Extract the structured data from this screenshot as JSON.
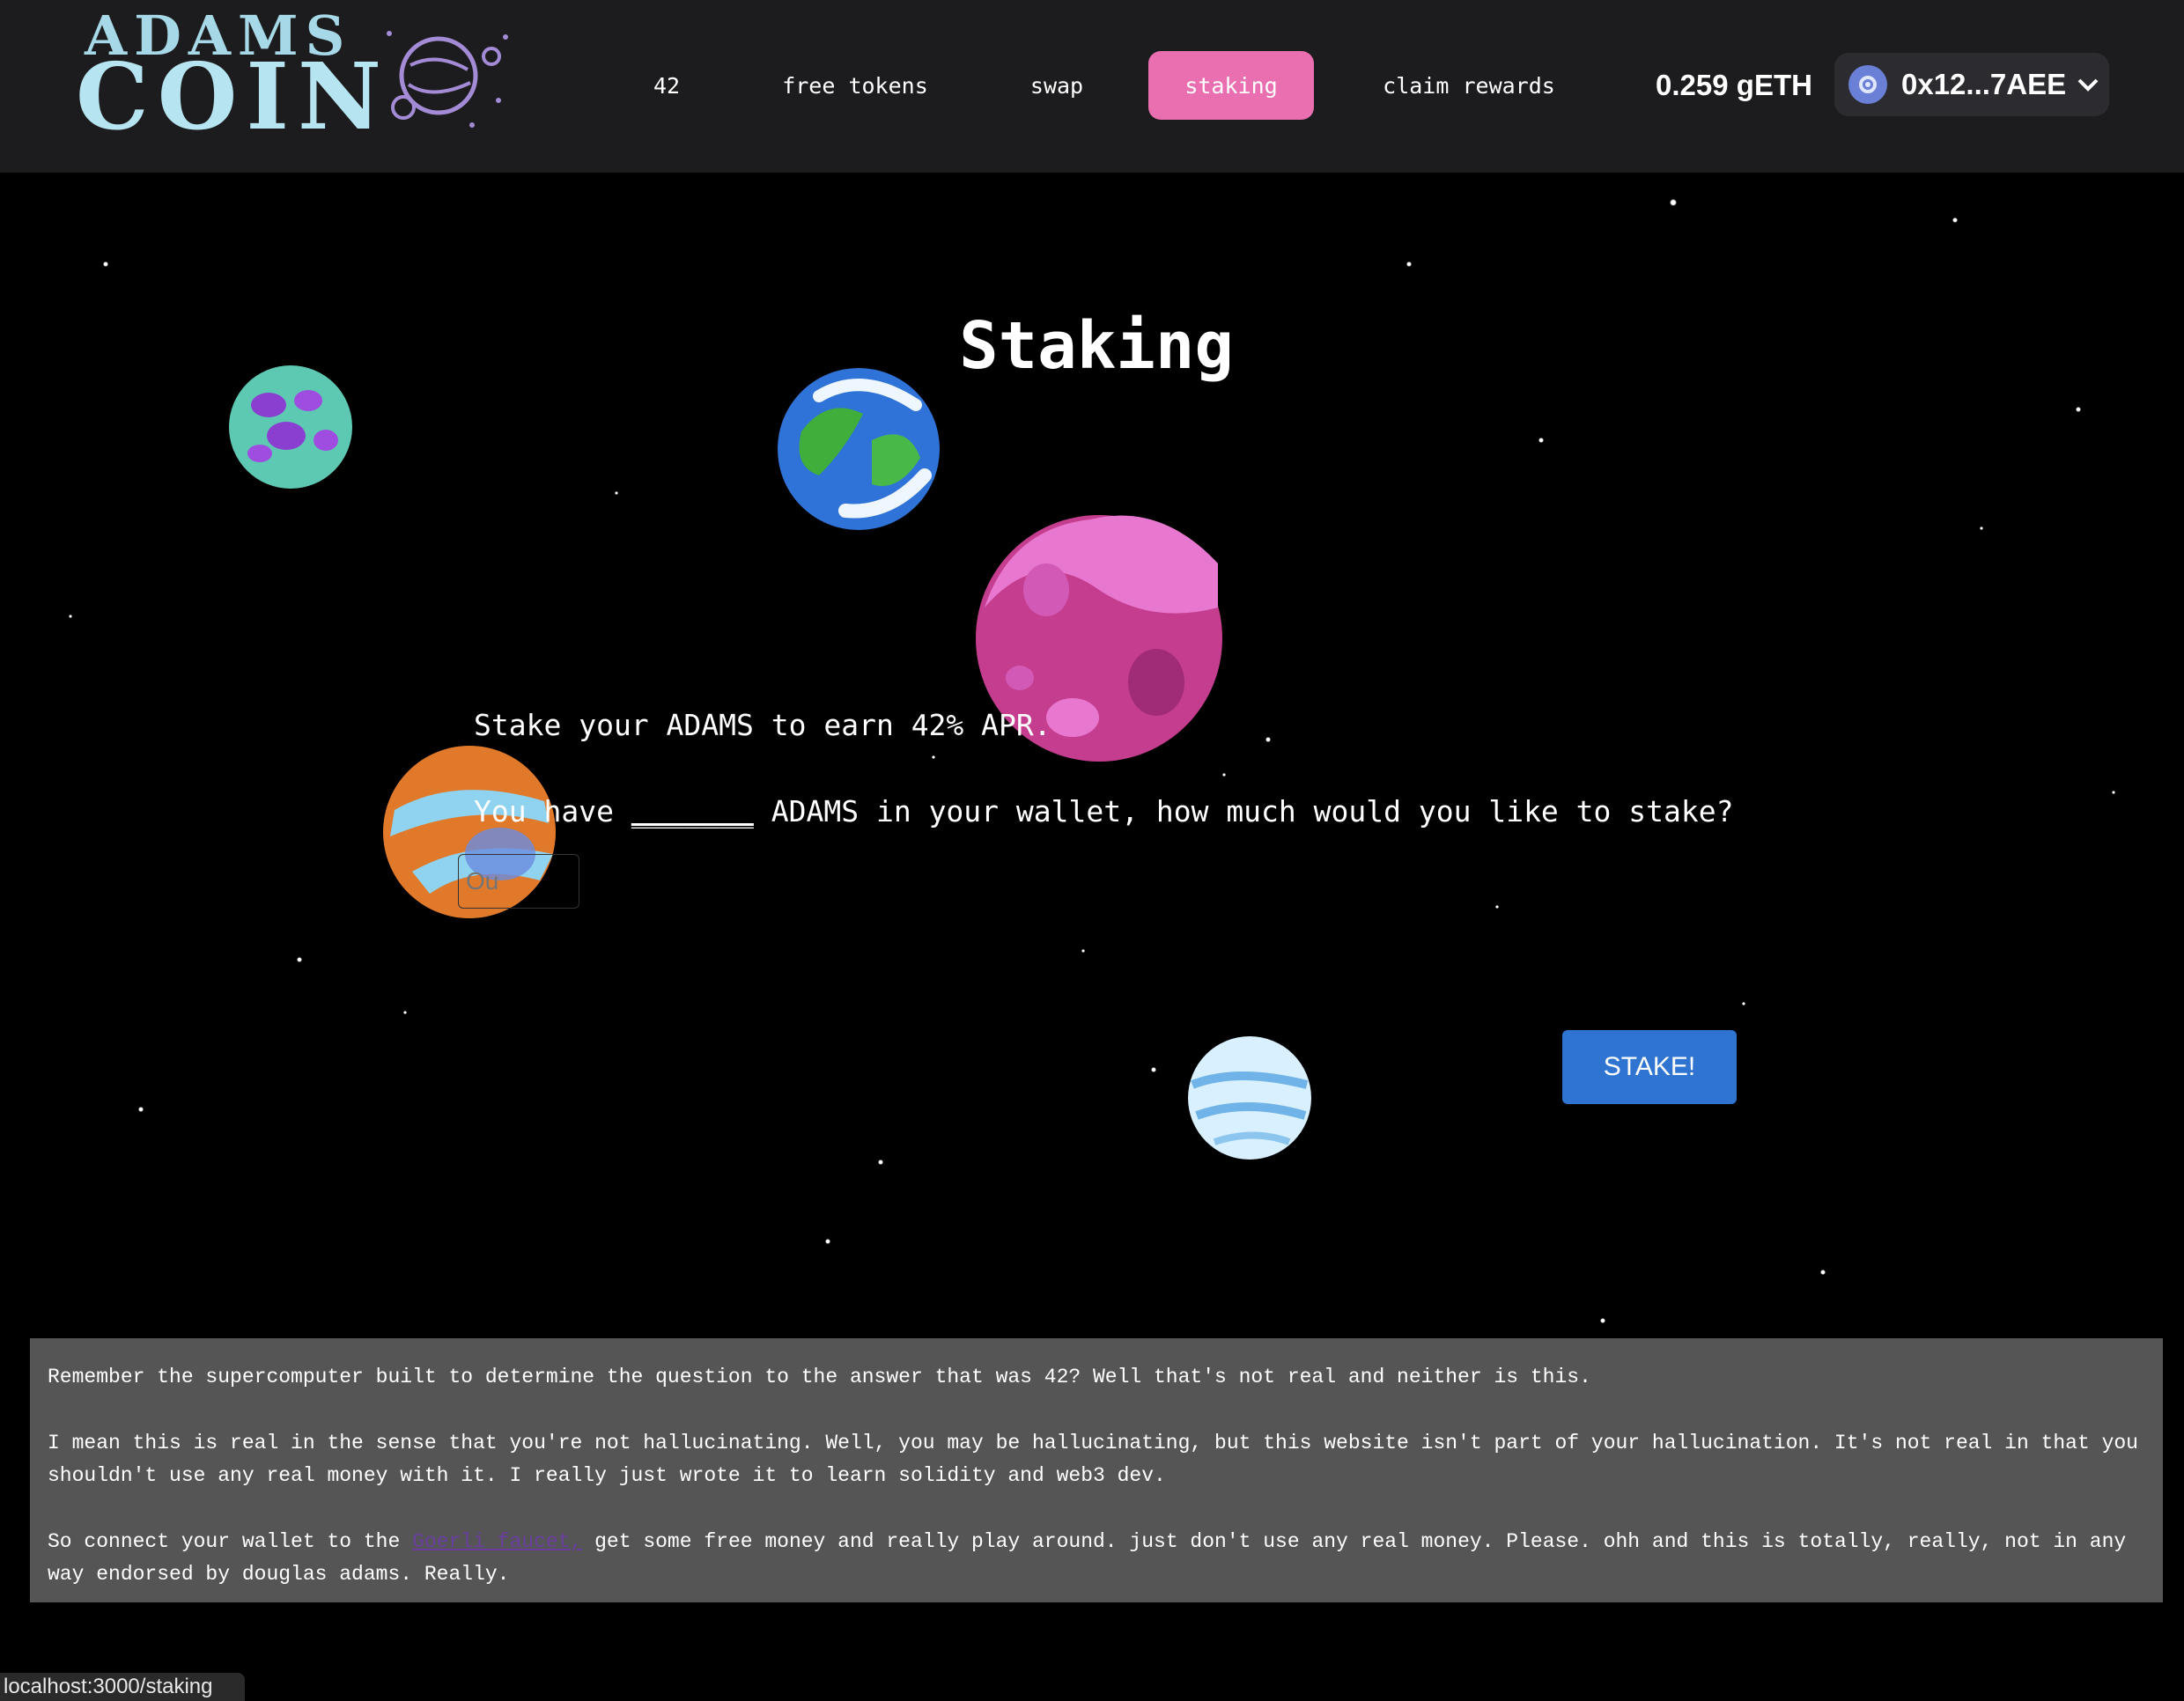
{
  "app": {
    "logo": {
      "line1": "ADAMS",
      "line2": "COIN",
      "icon": "planet-logo-icon"
    }
  },
  "nav": {
    "items": [
      {
        "label": "42"
      },
      {
        "label": "free tokens"
      },
      {
        "label": "swap"
      },
      {
        "label": "staking",
        "active": true
      },
      {
        "label": "claim rewards"
      }
    ]
  },
  "wallet": {
    "balance": "0.259 gETH",
    "address": "0x12...7AEE",
    "avatar_icon": "wallet-avatar-icon",
    "chevron_icon": "chevron-down-icon"
  },
  "staking": {
    "title": "Staking",
    "intro": "Stake your ADAMS to earn 42% APR.",
    "prompt_before": "You have ",
    "prompt_blank": "_______",
    "prompt_after": " ADAMS in your wallet, how much would you like to stake?",
    "input_value": "",
    "input_placeholder": "Ou",
    "stake_button": "STAKE!"
  },
  "footer": {
    "p1": "Remember the supercomputer built to determine the question to the answer that was 42? Well that's not real and neither is this.",
    "p2": "I mean this is real in the sense that you're not hallucinating. Well, you may be hallucinating, but this website isn't part of your hallucination. It's not real in that you shouldn't use any real money with it. I really just wrote it to learn solidity and web3 dev.",
    "p3_before": "So connect your wallet to the ",
    "p3_link": "Goerli faucet,",
    "p3_after": " get some free money and really play around. just don't use any real money. Please. ohh and this is totally, really, not in any way endorsed by douglas adams. Really."
  },
  "status_url": "localhost:3000/staking",
  "colors": {
    "topbar": "#1c1c1e",
    "active_nav": "#ea6fb0",
    "stake_button": "#2f74d0",
    "footer_bg": "#555555",
    "logo": "#b6e5f1"
  }
}
